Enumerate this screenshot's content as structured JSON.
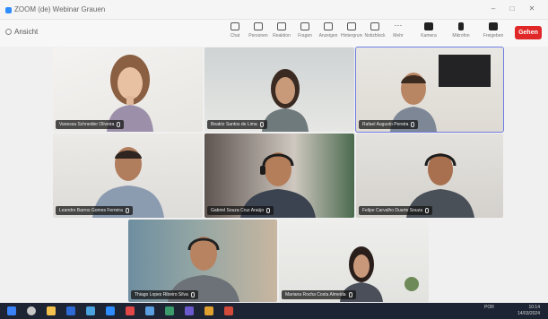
{
  "window": {
    "title": "ZOOM (de) Webinar Grauen"
  },
  "toolbar": {
    "view_label": "Ansicht",
    "items": [
      {
        "label": "Chat",
        "icon": "chat-icon"
      },
      {
        "label": "Personen",
        "icon": "people-icon"
      },
      {
        "label": "Reaktion",
        "icon": "reaction-icon"
      },
      {
        "label": "Fragen",
        "icon": "question-icon"
      },
      {
        "label": "Anzeigen",
        "icon": "view-icon"
      },
      {
        "label": "Hintergrund",
        "icon": "background-icon"
      },
      {
        "label": "Notizblock",
        "icon": "notes-icon"
      },
      {
        "label": "Mehr",
        "icon": "more-icon"
      },
      {
        "label": "Kamera",
        "icon": "camera-icon"
      },
      {
        "label": "Mikrofon",
        "icon": "microphone-icon"
      },
      {
        "label": "Freigeben",
        "icon": "share-icon"
      }
    ],
    "leave_label": "Gehen"
  },
  "participants": [
    {
      "name": "Vanessa Schneider Oliveira"
    },
    {
      "name": "Beatriz Santos de Lima"
    },
    {
      "name": "Rafael Augusto Pereira"
    },
    {
      "name": "Leandro Barros Gomes Ferreira"
    },
    {
      "name": "Gabriel Souza Cruz Araújo"
    },
    {
      "name": "Felipe Carvalho Duarte Souza"
    },
    {
      "name": "Thiago Lopes Ribeiro Silva"
    },
    {
      "name": "Mariana Rocha Costa Almeida"
    }
  ],
  "taskbar": {
    "time": "10:14",
    "date": "14/03/2024",
    "language": "POR"
  }
}
